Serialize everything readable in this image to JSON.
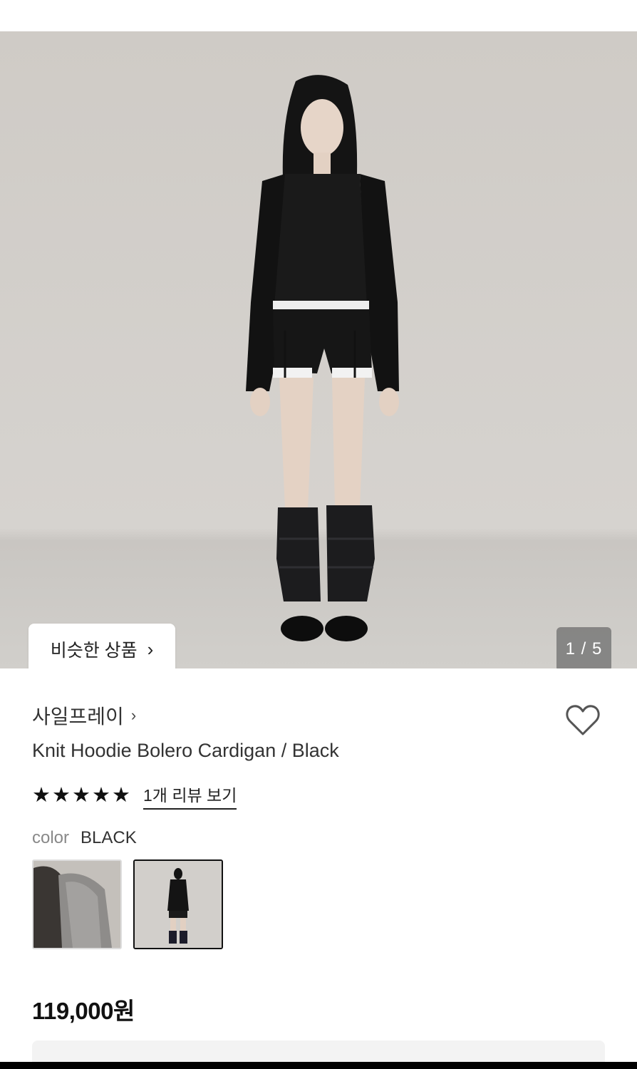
{
  "gallery": {
    "similar_label": "비슷한 상품",
    "counter": "1 / 5",
    "current_index": 1,
    "total": 5,
    "icons": {
      "chevron": "chevron-right-icon"
    }
  },
  "product": {
    "brand": "사일프레이",
    "name": "Knit Hoodie Bolero Cardigan / Black",
    "rating_stars": 5,
    "stars": [
      "★",
      "★",
      "★",
      "★",
      "★"
    ],
    "review_link": "1개 리뷰 보기",
    "color_label": "color",
    "color_value": "BLACK",
    "price": "119,000원",
    "swatches": [
      {
        "name": "grey",
        "selected": false
      },
      {
        "name": "black",
        "selected": true
      }
    ]
  },
  "colors": {
    "text_primary": "#111111",
    "text_muted": "#888888",
    "background": "#ffffff",
    "photo_background": "#d3d0cc"
  }
}
